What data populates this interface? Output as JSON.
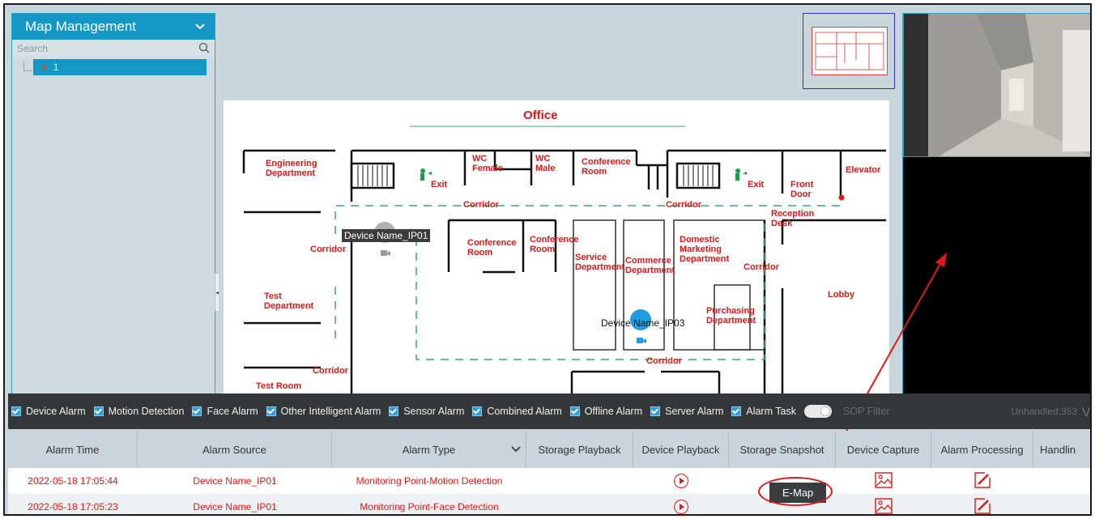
{
  "left_panel": {
    "title": "Map Management",
    "search_placeholder": "Search",
    "tree_item": "1"
  },
  "map": {
    "title": "Office",
    "labels": {
      "engineering": "Engineering\nDepartment",
      "exit1": "Exit",
      "wc_female": "WC\nFemale",
      "wc_male": "WC\nMale",
      "conf_top": "Conference\nRoom",
      "exit2": "Exit",
      "front_door": "Front\nDoor",
      "elevator": "Elevator",
      "corridor_top1": "Corridor",
      "corridor_top2": "Corridor",
      "reception": "Reception\nDesk",
      "corridor_left": "Corridor",
      "conf1": "Conference\nRoom",
      "conf2": "Conference\nRoom",
      "service": "Service\nDepartment",
      "commerce": "Commerce\nDepartment",
      "domestic": "Domestic\nMarketing\nDepartment",
      "corridor_right": "Corridor",
      "lobby": "Lobby",
      "test_dept": "Test\nDepartment",
      "purchasing": "Purchasing\nDepartment",
      "corridor_bottom": "Corridor",
      "corridor_lower_left": "Corridor",
      "test_room": "Test Room"
    },
    "devices": [
      {
        "name": "Device Name_IP01"
      },
      {
        "name": "Device Name_IP03"
      }
    ]
  },
  "alarm_filters": {
    "items": [
      "Device Alarm",
      "Motion Detection",
      "Face Alarm",
      "Other Intelligent Alarm",
      "Sensor Alarm",
      "Combined Alarm",
      "Offline Alarm",
      "Server Alarm",
      "Alarm Task"
    ],
    "sop_filter": "SOP Filter",
    "unhandled": "Unhandled:353"
  },
  "table": {
    "headers": [
      "Alarm Time",
      "Alarm Source",
      "Alarm Type",
      "Storage Playback",
      "Device Playback",
      "Storage Snapshot",
      "Device Capture",
      "Alarm Processing",
      "Handlin"
    ],
    "rows": [
      {
        "time": "2022-05-18 17:05:44",
        "source": "Device Name_IP01",
        "type": "Monitoring Point-Motion Detection"
      },
      {
        "time": "2022-05-18 17:05:23",
        "source": "Device Name_IP01",
        "type": "Monitoring Point-Face Detection"
      }
    ]
  },
  "tooltip": "E-Map",
  "colors": {
    "accent": "#1597c6",
    "alarm_red": "#e01818",
    "annotation": "#e01818"
  }
}
